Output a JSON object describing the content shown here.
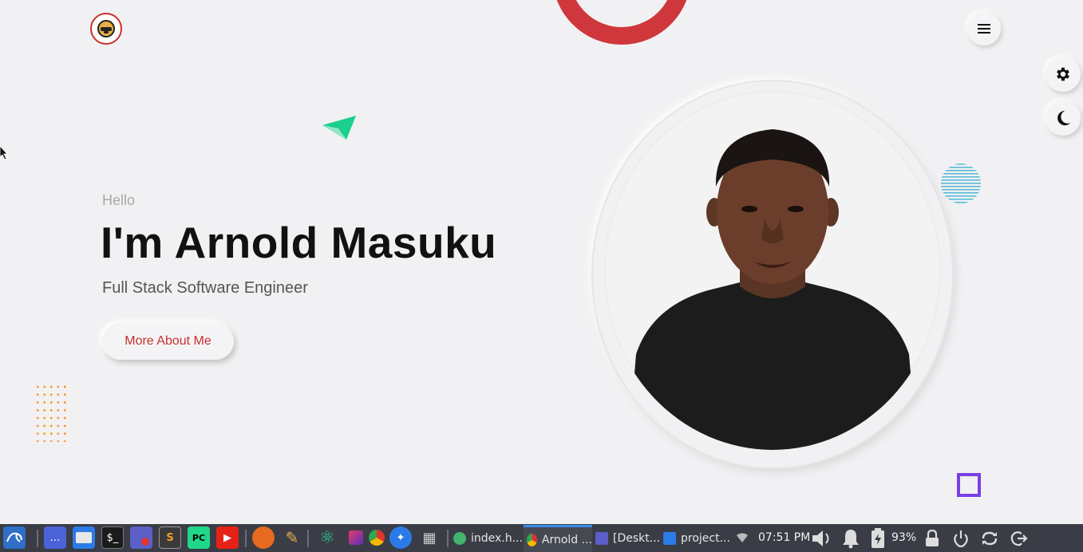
{
  "hero": {
    "greeting": "Hello",
    "name": "I'm Arnold Masuku",
    "role": "Full Stack Software Engineer",
    "cta_label": "More About Me"
  },
  "colors": {
    "accent_red": "#c9302c",
    "ring_red": "#d0373c",
    "plane_green": "#1ccf8c",
    "dots_orange": "#f39c2a",
    "stripe_blue": "#4fb6d6",
    "square_purple": "#7b3fe4",
    "background": "#f1f1f3"
  },
  "icons": {
    "logo": "avatar-logo-icon",
    "menu": "hamburger-menu-icon",
    "settings": "gear-icon",
    "theme": "moon-icon"
  },
  "taskbar": {
    "tasks": [
      {
        "label": "index.h...",
        "icon": "atom-icon"
      },
      {
        "label": "Arnold ...",
        "icon": "chrome-icon"
      },
      {
        "label": "[Deskt...",
        "icon": "remote-desktop-icon"
      },
      {
        "label": "project...",
        "icon": "folder-icon"
      }
    ],
    "clock": "07:51 PM",
    "battery": "93%"
  }
}
